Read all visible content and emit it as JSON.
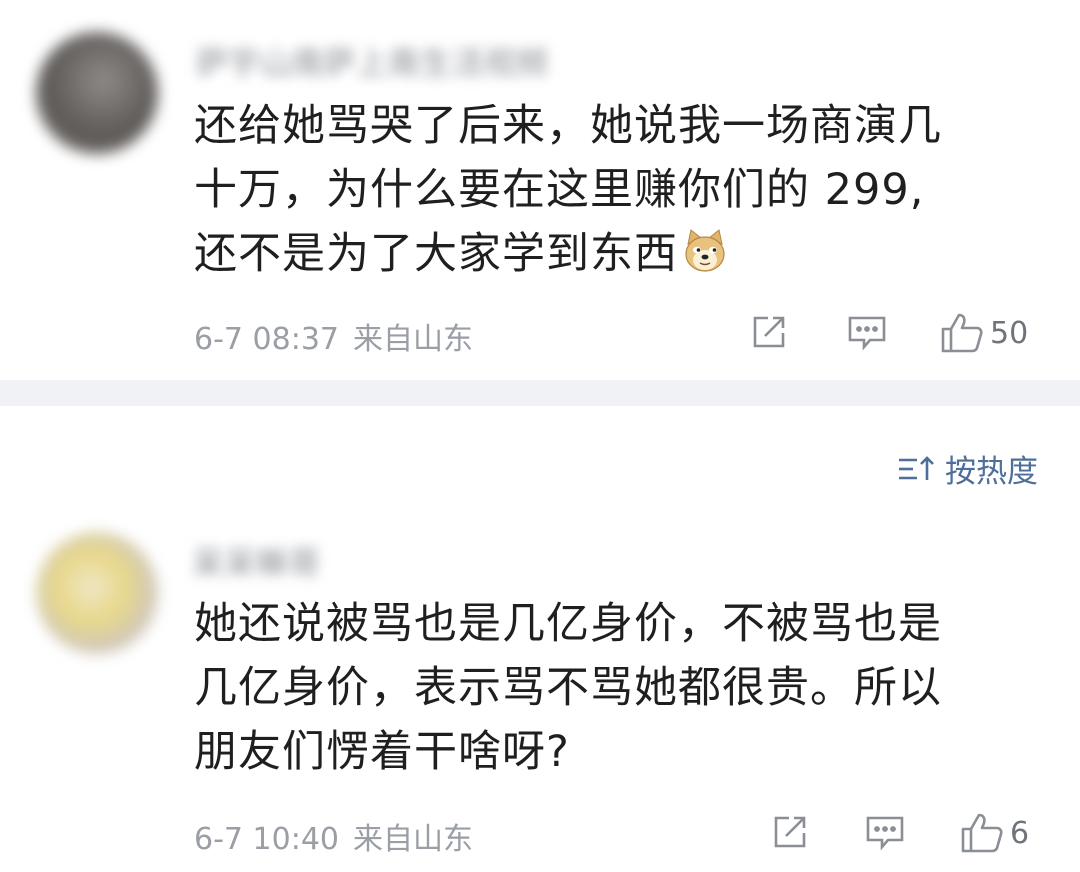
{
  "comments": [
    {
      "username": "萨宇山南萨上南生活视频",
      "text_lines": [
        "还给她骂哭了后来，她说我一场商演几",
        "十万，为什么要在这里赚你们的 299,",
        "还不是为了大家学到东西"
      ],
      "emoji": "doge-emoji",
      "date": "6-7 08:37",
      "location": "来自山东",
      "likes": "50"
    },
    {
      "username": "呆呆嘛哥",
      "text_lines": [
        "她还说被骂也是几亿身价，不被骂也是",
        "几亿身价，表示骂不骂她都很贵。所以",
        "朋友们愣着干啥呀?"
      ],
      "date": "6-7 10:40",
      "location": "来自山东",
      "likes": "6"
    }
  ],
  "sort": {
    "label": "按热度",
    "icon": "sort-icon"
  },
  "icons": {
    "repost": "repost-icon",
    "reply": "reply-icon",
    "like": "like-icon"
  },
  "colors": {
    "accent": "#4f6e9a",
    "separator": "#f1f2f5",
    "meta_text": "#9a9ea5"
  }
}
